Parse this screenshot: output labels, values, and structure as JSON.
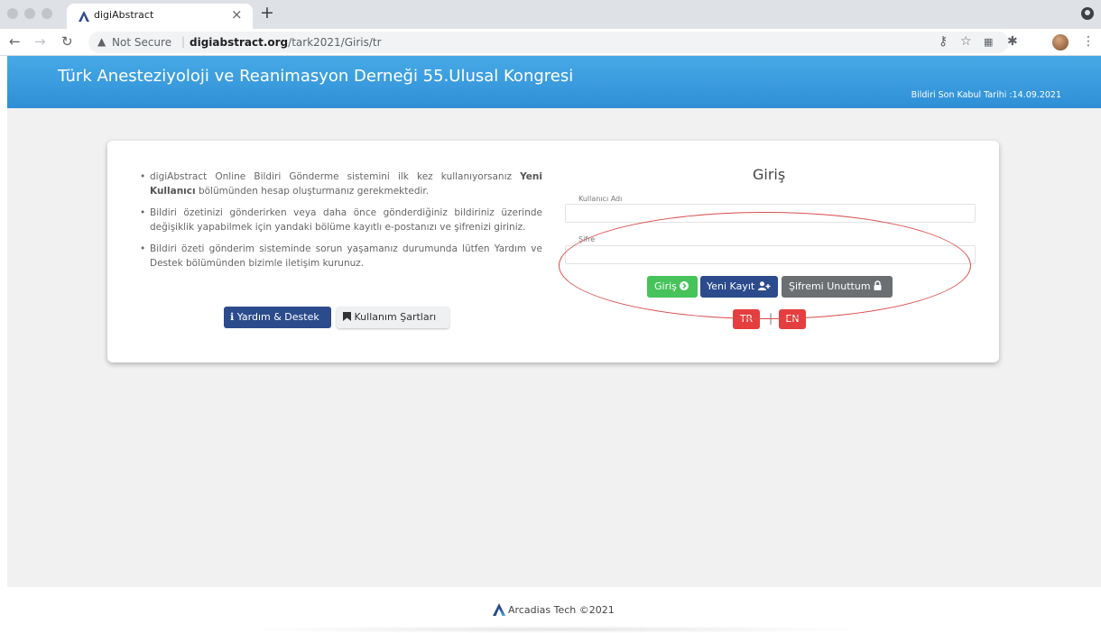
{
  "browser": {
    "tab_title": "digiAbstract",
    "close_glyph": "×",
    "new_tab_glyph": "+",
    "not_secure": "Not Secure",
    "url_domain": "digiabstract.org",
    "url_path": "/tark2021/Giris/tr",
    "icons": [
      "back-icon",
      "forward-icon",
      "reload-icon",
      "warning-icon",
      "key-icon",
      "star-icon",
      "qr-icon",
      "extensions-icon",
      "profile-avatar",
      "menu-icon"
    ]
  },
  "header": {
    "title": "Türk Anesteziyoloji ve Reanimasyon Derneği 55.Ulusal Kongresi",
    "deadline": "Bildiri Son Kabul Tarihi :14.09.2021",
    "background": "#3b9de0"
  },
  "info": {
    "item1_part1": "digiAbstract Online Bildiri Gönderme sistemini ilk kez kullanıyorsanız ",
    "item1_bold": "Yeni Kullanıcı",
    "item1_part2": " bölümünden hesap oluşturmanız gerekmektedir.",
    "item2": "Bildiri özetinizi gönderirken veya daha önce gönderdiğiniz bildiriniz üzerinde değişiklik yapabilmek için yandaki bölüme kayıtlı e-postanızı ve şifrenizi giriniz.",
    "item3": "Bildiri özeti gönderim sisteminde sorun yaşamanız durumunda lütfen Yardım ve Destek bölümünden bizimle iletişim kurunuz.",
    "help_button": "Yardım & Destek",
    "terms_button": "Kullanım Şartları"
  },
  "login": {
    "title": "Giriş",
    "username_label": "Kullanıcı Adı",
    "username_value": "",
    "password_label": "Şifre",
    "password_value": "",
    "login_button": "Giriş",
    "register_button": "Yeni Kayıt",
    "forgot_button": "Şifremi Unuttum",
    "lang_tr": "TR",
    "lang_separator": "|",
    "lang_en": "EN"
  },
  "footer": {
    "text": "Arcadias Tech ©2021"
  },
  "colors": {
    "primary_blue": "#2b4b8c",
    "success_green": "#46c35a",
    "danger_red": "#e53e3e",
    "annotation_red": "#d84c4c"
  }
}
